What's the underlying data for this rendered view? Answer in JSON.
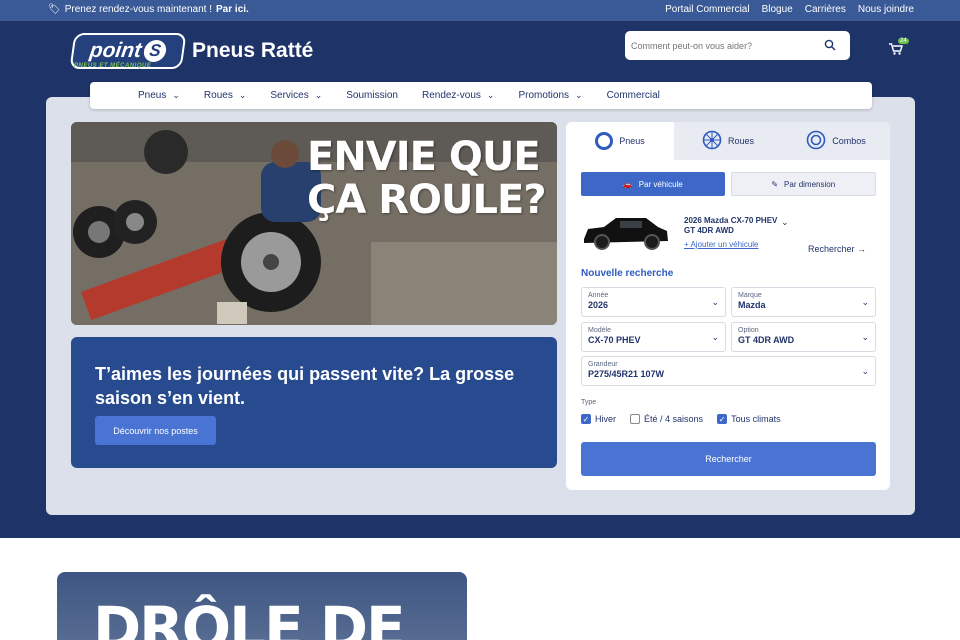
{
  "topbar": {
    "promo_text": "Prenez rendez-vous maintenant !",
    "promo_link": "Par ici.",
    "links": [
      "Portail Commercial",
      "Blogue",
      "Carrières",
      "Nous joindre"
    ]
  },
  "logo": {
    "badge": "point",
    "badge_s": "S",
    "tagline": "PNEUS ET MÉCANIQUE",
    "brand": "Pneus Ratté"
  },
  "search": {
    "placeholder": "Comment peut-on vous aider?"
  },
  "cart": {
    "count": "24"
  },
  "nav": {
    "items": [
      "Pneus",
      "Roues",
      "Services",
      "Soumission",
      "Rendez-vous",
      "Promotions",
      "Commercial"
    ]
  },
  "banner": {
    "headline_1": "ENVIE QUE",
    "headline_2": "ÇA ROULE?"
  },
  "promo_card": {
    "title": "T’aimes les journées qui passent vite? La grosse saison s’en vient.",
    "button": "Découvrir nos postes"
  },
  "form": {
    "tabs": [
      "Pneus",
      "Roues",
      "Combos"
    ],
    "sub_tabs": [
      "Par véhicule",
      "Par dimension"
    ],
    "vehicle_line1": "2026 Mazda CX-70 PHEV",
    "vehicle_line2": "GT 4DR AWD",
    "add_vehicle": "+ Ajouter un véhicule",
    "search_link": "Rechercher",
    "new_search": "Nouvelle recherche",
    "fields": {
      "annee": {
        "label": "Année",
        "value": "2026"
      },
      "marque": {
        "label": "Marque",
        "value": "Mazda"
      },
      "modele": {
        "label": "Modèle",
        "value": "CX-70 PHEV"
      },
      "option": {
        "label": "Option",
        "value": "GT 4DR AWD"
      },
      "grandeur": {
        "label": "Grandeur",
        "value": "P275/45R21 107W"
      }
    },
    "type_label": "Type",
    "types": [
      {
        "label": "Hiver",
        "checked": true
      },
      {
        "label": "Été / 4 saisons",
        "checked": false
      },
      {
        "label": "Tous climats",
        "checked": true
      }
    ],
    "submit": "Rechercher"
  },
  "bottom_card": {
    "title": "DRÔLE DE"
  },
  "colors": {
    "topbar": "#3a5a97",
    "hero": "#1e3368",
    "accent": "#4a74d4",
    "green": "#6abf4b"
  }
}
